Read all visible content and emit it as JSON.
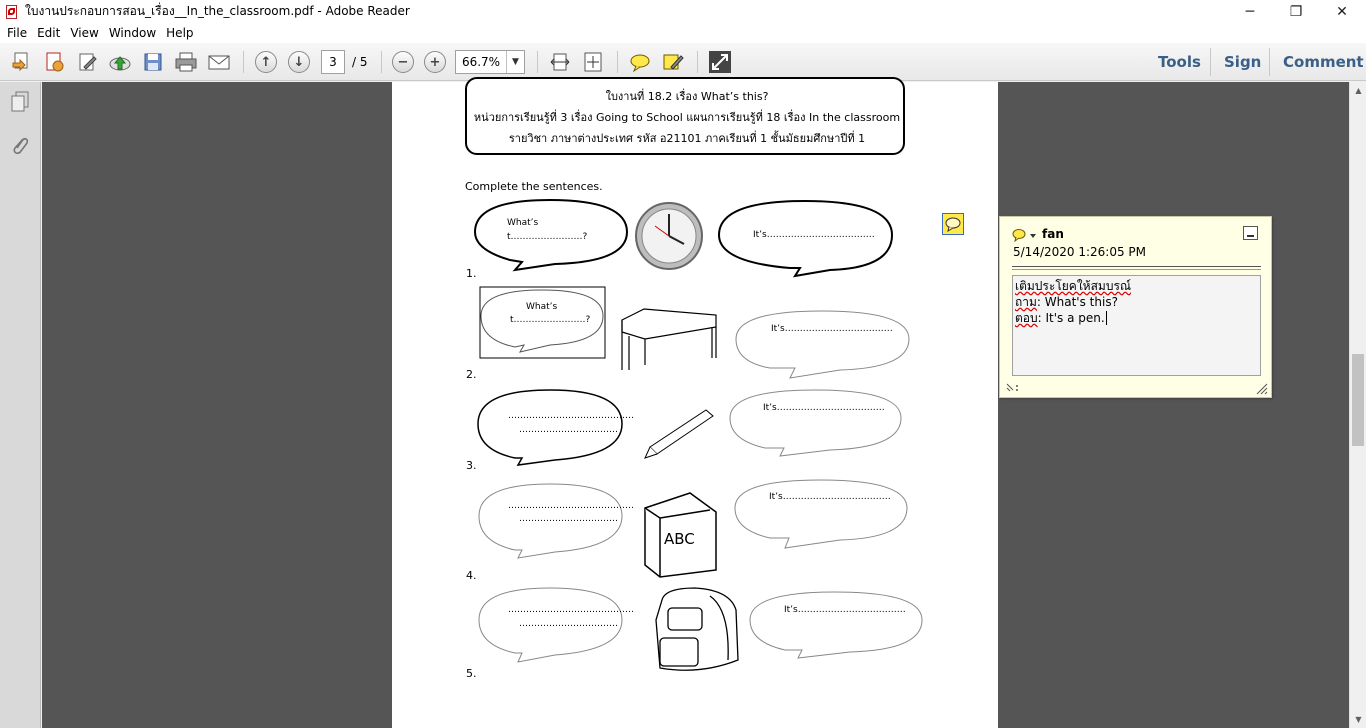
{
  "window": {
    "title": "ใบงานประกอบการสอน_เรื่อง__In_the_classroom.pdf - Adobe Reader",
    "minimize": "─",
    "restore": "❐",
    "close": "✕"
  },
  "menu": {
    "items": [
      "File",
      "Edit",
      "View",
      "Window",
      "Help"
    ]
  },
  "toolbar": {
    "page_current": "3",
    "page_total": "/  5",
    "zoom": "66.7%",
    "tools_label": "Tools",
    "sign_label": "Sign",
    "comment_label": "Comment"
  },
  "document": {
    "header_line1": "ใบงานที่ 18.2  เรื่อง What’s this?",
    "header_line2": "หน่วยการเรียนรู้ที่ 3 เรื่อง Going to School แผนการเรียนรู้ที่ 18 เรื่อง In the classroom",
    "header_line3": "รายวิชา ภาษาต่างประเทศ  รหัส อ21101 ภาคเรียนที่ 1 ชั้นมัธยมศึกษาปีที่ 1",
    "instruction": "Complete the sentences.",
    "example_question_1": "What’s",
    "example_question_2": "t……………………?",
    "example_answer": "It’s………………………………",
    "q1_question_1": "What’s",
    "q1_question_2": "t……………………?",
    "q1_answer": "It’s………………………………",
    "q2_line_1": "……………………………………",
    "q2_line_2": "……………………………",
    "q2_answer": "It’s………………………………",
    "q3_line_1": "……………………………………",
    "q3_line_2": "……………………………",
    "q3_answer": "It’s………………………………",
    "q4_line_1": "……………………………………",
    "q4_line_2": "……………………………",
    "q4_answer": "It’s………………………………",
    "book_label": "ABC",
    "numbers": [
      "1.",
      "2.",
      "3.",
      "4.",
      "5."
    ]
  },
  "note": {
    "author": "fan",
    "date": "5/14/2020 1:26:05 PM",
    "line1": "เติมประโยคให้สมบรณ์",
    "line2_prefix": "ถาม",
    "line2_rest": ": What's this?",
    "line3_prefix": "ตอบ",
    "line3_rest": ": It's a pen."
  }
}
